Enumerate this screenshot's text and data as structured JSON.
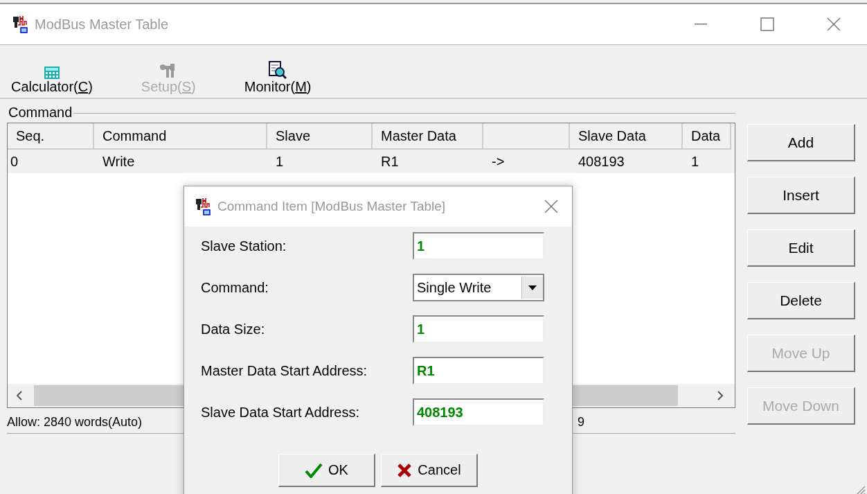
{
  "window": {
    "title": "ModBus Master Table"
  },
  "toolbar": [
    {
      "label": "Calculator(",
      "mnemonic": "C",
      "suffix": ")",
      "kind": "calculator",
      "disabled": false
    },
    {
      "label": "Setup(",
      "mnemonic": "S",
      "suffix": ")",
      "kind": "setup",
      "disabled": true
    },
    {
      "label": "Monitor(",
      "mnemonic": "M",
      "suffix": ")",
      "kind": "monitor",
      "disabled": false
    }
  ],
  "group": {
    "title": "Command"
  },
  "table": {
    "columns": [
      "Seq.",
      "Command",
      "Slave",
      "Master Data",
      "",
      "Slave Data",
      "Data"
    ],
    "rows": [
      {
        "cells": [
          "0",
          "Write",
          "1",
          "R1",
          "->",
          "408193",
          "1"
        ],
        "selected": true
      }
    ]
  },
  "status_bar": {
    "text": "Allow: 2840 words(Auto)",
    "text_2": "9"
  },
  "buttons": [
    {
      "label": "Add",
      "disabled": false
    },
    {
      "label": "Insert",
      "disabled": false
    },
    {
      "label": "Edit",
      "disabled": false
    },
    {
      "label": "Delete",
      "disabled": false
    },
    {
      "label": "Move Up",
      "disabled": true
    },
    {
      "label": "Move Down",
      "disabled": true
    }
  ],
  "dialog": {
    "title": "Command Item [ModBus Master Table]",
    "fields": [
      {
        "label": "Slave Station:",
        "value": "1",
        "kind": "text"
      },
      {
        "label": "Command:",
        "value": "Single Write",
        "kind": "select"
      },
      {
        "label": "Data Size:",
        "value": "1",
        "kind": "text"
      },
      {
        "label": "Master Data Start Address:",
        "value": "R1",
        "kind": "text"
      },
      {
        "label": "Slave Data Start Address:",
        "value": "408193",
        "kind": "text"
      }
    ],
    "buttons": [
      {
        "label": "OK",
        "kind": "ok"
      },
      {
        "label": "Cancel",
        "kind": "cancel"
      }
    ]
  }
}
